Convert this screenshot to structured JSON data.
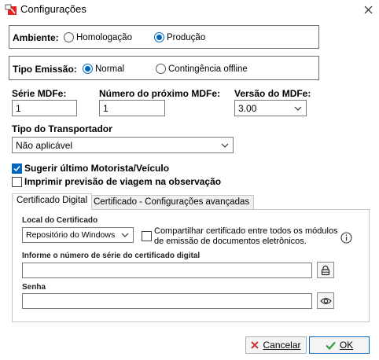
{
  "window": {
    "title": "Configurações"
  },
  "ambiente": {
    "label": "Ambiente:",
    "options": [
      "Homologação",
      "Produção"
    ],
    "selected": "Produção"
  },
  "tipo_emissao": {
    "label": "Tipo Emissão:",
    "options": [
      "Normal",
      "Contingência offline"
    ],
    "selected": "Normal"
  },
  "serie": {
    "label": "Série MDFe:",
    "value": "1"
  },
  "numero": {
    "label": "Número do próximo MDFe:",
    "value": "1"
  },
  "versao": {
    "label": "Versão do MDFe:",
    "value": "3.00"
  },
  "transportador": {
    "label": "Tipo do Transportador",
    "value": "Não aplicável"
  },
  "checks": {
    "sugerir": {
      "label": "Sugerir último Motorista/Veículo",
      "checked": true
    },
    "imprimir": {
      "label": "Imprimir previsão de viagem na observação",
      "checked": false
    }
  },
  "tabs": [
    {
      "label": "Certificado Digital",
      "active": true
    },
    {
      "label": "Certificado - Configurações avançadas",
      "active": false
    }
  ],
  "cert": {
    "local_label": "Local do Certificado",
    "local_value": "Repositório do Windows",
    "compartilhar_label": "Compartilhar certificado entre todos os módulos de emissão de documentos eletrônicos.",
    "serie_label": "Informe o número de série do certificado digital",
    "serie_value": "",
    "senha_label": "Senha",
    "senha_value": ""
  },
  "buttons": {
    "cancel": "Cancelar",
    "ok": "OK"
  },
  "colors": {
    "accent": "#0067c0",
    "cancel_x": "#d13438",
    "ok_check": "#2e9e3e"
  }
}
